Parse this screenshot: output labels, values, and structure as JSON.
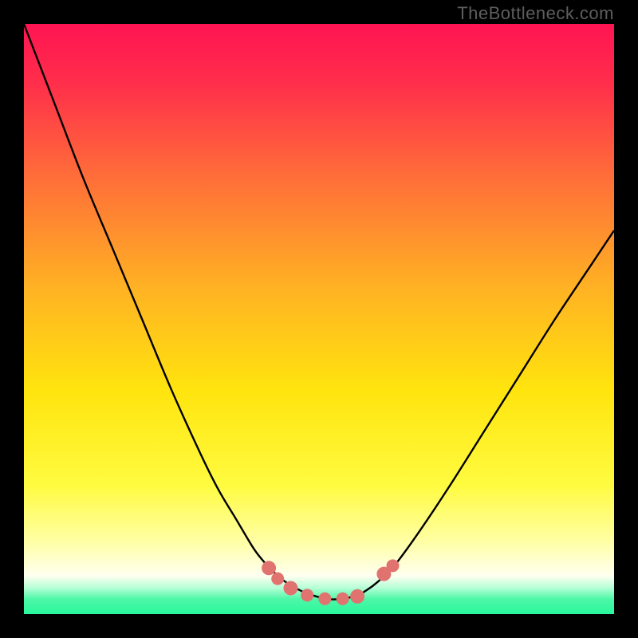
{
  "attribution": "TheBottleneck.com",
  "chart_data": {
    "type": "line",
    "title": "",
    "xlabel": "",
    "ylabel": "",
    "xlim": [
      0,
      1
    ],
    "ylim": [
      0,
      1
    ],
    "series": [
      {
        "name": "curve",
        "x": [
          0.0,
          0.05,
          0.1,
          0.15,
          0.2,
          0.25,
          0.3,
          0.33,
          0.36,
          0.39,
          0.41,
          0.43,
          0.45,
          0.48,
          0.52,
          0.56,
          0.58,
          0.6,
          0.63,
          0.67,
          0.72,
          0.78,
          0.84,
          0.9,
          0.96,
          1.0
        ],
        "y": [
          1.0,
          0.87,
          0.74,
          0.62,
          0.5,
          0.38,
          0.27,
          0.21,
          0.16,
          0.11,
          0.085,
          0.065,
          0.05,
          0.035,
          0.025,
          0.03,
          0.04,
          0.055,
          0.085,
          0.14,
          0.215,
          0.31,
          0.405,
          0.5,
          0.59,
          0.65
        ]
      }
    ],
    "markers": [
      {
        "x": 0.415,
        "y": 0.078,
        "r": 9
      },
      {
        "x": 0.43,
        "y": 0.06,
        "r": 8
      },
      {
        "x": 0.452,
        "y": 0.044,
        "r": 9
      },
      {
        "x": 0.48,
        "y": 0.032,
        "r": 8
      },
      {
        "x": 0.51,
        "y": 0.026,
        "r": 8
      },
      {
        "x": 0.54,
        "y": 0.026,
        "r": 8
      },
      {
        "x": 0.565,
        "y": 0.03,
        "r": 9
      },
      {
        "x": 0.61,
        "y": 0.068,
        "r": 9
      },
      {
        "x": 0.625,
        "y": 0.082,
        "r": 8
      }
    ],
    "colors": {
      "curve": "#000000",
      "marker": "#e0736f",
      "bottom_band": "#2af79d",
      "gradient_stops": [
        {
          "offset": 0.0,
          "color": "#ff1452"
        },
        {
          "offset": 0.1,
          "color": "#ff2e4b"
        },
        {
          "offset": 0.25,
          "color": "#ff6a3a"
        },
        {
          "offset": 0.45,
          "color": "#ffb323"
        },
        {
          "offset": 0.62,
          "color": "#ffe40e"
        },
        {
          "offset": 0.78,
          "color": "#fffb3f"
        },
        {
          "offset": 0.88,
          "color": "#ffffa8"
        },
        {
          "offset": 0.935,
          "color": "#fffff0"
        },
        {
          "offset": 0.955,
          "color": "#b8ffd8"
        },
        {
          "offset": 0.975,
          "color": "#4cf7a6"
        },
        {
          "offset": 1.0,
          "color": "#2af79d"
        }
      ]
    }
  }
}
